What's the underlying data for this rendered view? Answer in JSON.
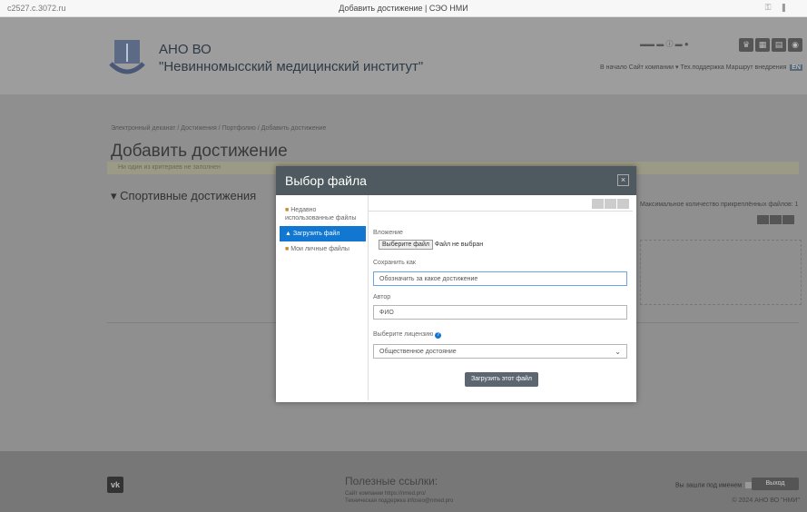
{
  "browser": {
    "url": "c2527.c.3072.ru",
    "title": "Добавить достижение | СЭО НМИ"
  },
  "header": {
    "org_line1": "АНО ВО",
    "org_line2": "\"Невинномысский медицинский институт\"",
    "nav": [
      "В начало",
      "Сайт компании ▾",
      "Тех.поддержка",
      "Маршрут внедрения"
    ],
    "lang": "EN"
  },
  "breadcrumb": "Электронный деканат / Достижения / Портфолио / Добавить достижение",
  "page_title": "Добавить достижение",
  "warning": "Ни один из критериев не заполнен",
  "section": "Спортивные достижения",
  "right_note": "Максимальное количество прикреплённых файлов: 1",
  "modal": {
    "title": "Выбор файла",
    "sidebar": [
      {
        "label": "Недавно использованные файлы",
        "icon": "folder-icon"
      },
      {
        "label": "Загрузить файл",
        "icon": "upload-icon"
      },
      {
        "label": "Мои личные файлы",
        "icon": "folder-icon"
      }
    ],
    "attachment_label": "Вложение",
    "choose_file": "Выберите файл",
    "no_file": "Файл не выбран",
    "save_as_label": "Сохранить как",
    "save_as_value": "Обозначить за какое достижение",
    "author_label": "Автор",
    "author_value": "ФИО",
    "license_label": "Выберите лицензию",
    "license_value": "Общественное достояние",
    "upload_button": "Загрузить этот файл"
  },
  "footer": {
    "title": "Полезные ссылки:",
    "link1": "Сайт компании https://nmed.pro/",
    "link2": "Техническая поддержка infoseo@nmed.pro",
    "logged_in": "Вы зашли под именем",
    "logout": "Выход",
    "copyright": "© 2024 АНО ВО \"НМИ\""
  }
}
